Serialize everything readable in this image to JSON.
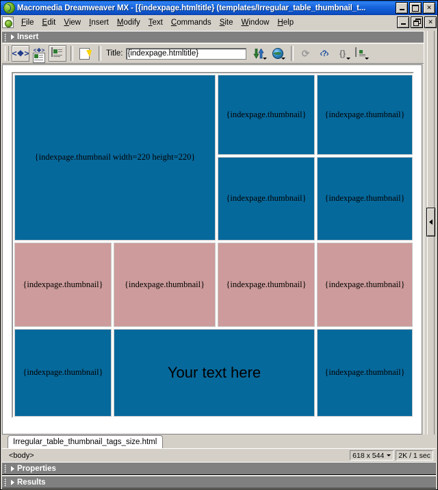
{
  "window": {
    "title": "Macromedia Dreamweaver MX - [{indexpage.htmltitle} (templates/Irregular_table_thumbnail_t...",
    "app_icon": "dreamweaver-icon",
    "buttons": {
      "minimize": "minimize-icon",
      "maximize": "maximize-icon",
      "close": "close-icon",
      "doc_minimize": "minimize-icon",
      "doc_restore": "restore-icon",
      "doc_close": "close-icon"
    }
  },
  "menubar": {
    "doc_icon": "document-icon",
    "items": [
      {
        "label": "File",
        "acc": "F",
        "rest": "ile"
      },
      {
        "label": "Edit",
        "acc": "E",
        "rest": "dit"
      },
      {
        "label": "View",
        "acc": "V",
        "rest": "iew"
      },
      {
        "label": "Insert",
        "acc": "I",
        "rest": "nsert"
      },
      {
        "label": "Modify",
        "acc": "M",
        "rest": "odify"
      },
      {
        "label": "Text",
        "acc": "T",
        "rest": "ext"
      },
      {
        "label": "Commands",
        "acc": "C",
        "rest": "ommands"
      },
      {
        "label": "Site",
        "acc": "S",
        "rest": "ite"
      },
      {
        "label": "Window",
        "acc": "W",
        "rest": "indow"
      },
      {
        "label": "Help",
        "acc": "H",
        "rest": "elp"
      }
    ]
  },
  "insert_panel": {
    "label": "Insert",
    "expander": "triangle-right-icon",
    "grip": "drag-grip-icon"
  },
  "toolbar": {
    "view_code_icon": "show-code-view-icon",
    "view_split_icon": "show-code-and-design-views-icon",
    "view_design_icon": "show-design-view-icon",
    "live_data_icon": "live-data-view-icon",
    "title_label": "Title:",
    "title_value": "{indexpage.htmltitle}",
    "title_placeholder": "Untitled Document",
    "file_management_icon": "file-management-arrows-icon",
    "preview_icon": "preview-debug-in-browser-globe-icon",
    "refresh_icon": "refresh-design-view-icon",
    "reference_icon": "reference-code-icon",
    "code_navigation_icon": "code-navigation-braces-icon",
    "view_options_icon": "view-options-icon"
  },
  "document": {
    "table": {
      "rows": [
        {
          "name": "row-1",
          "cells": [
            {
              "text": "{indexpage.thumbnail width=220 height=220}",
              "color": "blue",
              "span": "large",
              "big": false
            },
            {
              "text": "{indexpage.thumbnail}",
              "color": "blue",
              "big": false
            },
            {
              "text": "{indexpage.thumbnail}",
              "color": "blue",
              "big": false
            }
          ]
        },
        {
          "name": "row-2",
          "cells": [
            {
              "text": "{indexpage.thumbnail}",
              "color": "blue",
              "big": false
            },
            {
              "text": "{indexpage.thumbnail}",
              "color": "blue",
              "big": false
            }
          ]
        },
        {
          "name": "row-3",
          "cells": [
            {
              "text": "{indexpage.thumbnail}",
              "color": "pink",
              "big": false
            },
            {
              "text": "{indexpage.thumbnail}",
              "color": "pink",
              "big": false
            },
            {
              "text": "{indexpage.thumbnail}",
              "color": "pink",
              "big": false
            },
            {
              "text": "{indexpage.thumbnail}",
              "color": "pink",
              "big": false
            }
          ]
        },
        {
          "name": "row-4",
          "cells": [
            {
              "text": "{indexpage.thumbnail}",
              "color": "blue",
              "big": false
            },
            {
              "text": "Your text here",
              "color": "blue",
              "big": true
            },
            {
              "text": "{indexpage.thumbnail}",
              "color": "blue",
              "big": false
            }
          ]
        }
      ]
    },
    "splitter_handle_icon": "collapse-panel-arrow-icon"
  },
  "tabs": [
    {
      "label": "Irregular_table_thumbnail_tags_size.html",
      "active": true
    }
  ],
  "statusbar": {
    "tag_selector": "<body>",
    "window_size": "618 x 544",
    "download_size": "2K / 1 sec",
    "size_caret_icon": "chevron-down-icon"
  },
  "panels": [
    {
      "label": "Properties",
      "expander": "triangle-right-icon"
    },
    {
      "label": "Results",
      "expander": "triangle-right-icon"
    }
  ],
  "colors": {
    "cell_blue": "#06699c",
    "cell_pink": "#cd9b9b",
    "chrome": "#d4d0c8",
    "panel_header": "#808080",
    "titlebar_blue": "#1664dd"
  }
}
